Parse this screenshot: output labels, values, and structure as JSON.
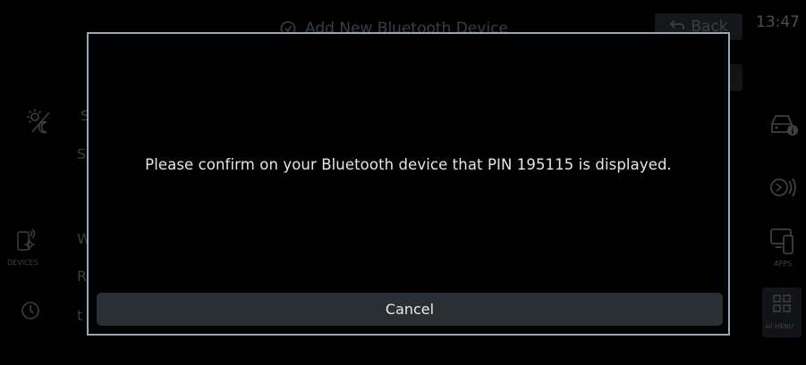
{
  "header": {
    "title": "Add New Bluetooth Device",
    "title_icon": "bluetooth-search-icon",
    "back_label": "Back",
    "back_icon": "back-arrow-icon",
    "clock": "13:47"
  },
  "left_sidebar": {
    "brightness_icon": "brightness-icon",
    "devices_label": "DEVICES",
    "devices_icon": "device-settings-icon",
    "power_icon": "power-icon",
    "background_letters": [
      "S",
      "S",
      "W",
      "R",
      "t"
    ]
  },
  "right_sidebar": {
    "car_icon": "car-info-icon",
    "sound_icon": "sound-icon",
    "apps_label": "APPS",
    "apps_icon": "phone-projection-icon",
    "allmenu_label": "All MENU",
    "allmenu_icon": "grid-menu-icon"
  },
  "modal": {
    "message": "Please confirm on your Bluetooth device that PIN 195115 is displayed.",
    "cancel_label": "Cancel"
  },
  "colors": {
    "background": "#000000",
    "modal_border": "#9aa7b4",
    "button_bg": "#2a2f34",
    "text": "#e6e6e6",
    "dim_text": "#3a3f44"
  }
}
